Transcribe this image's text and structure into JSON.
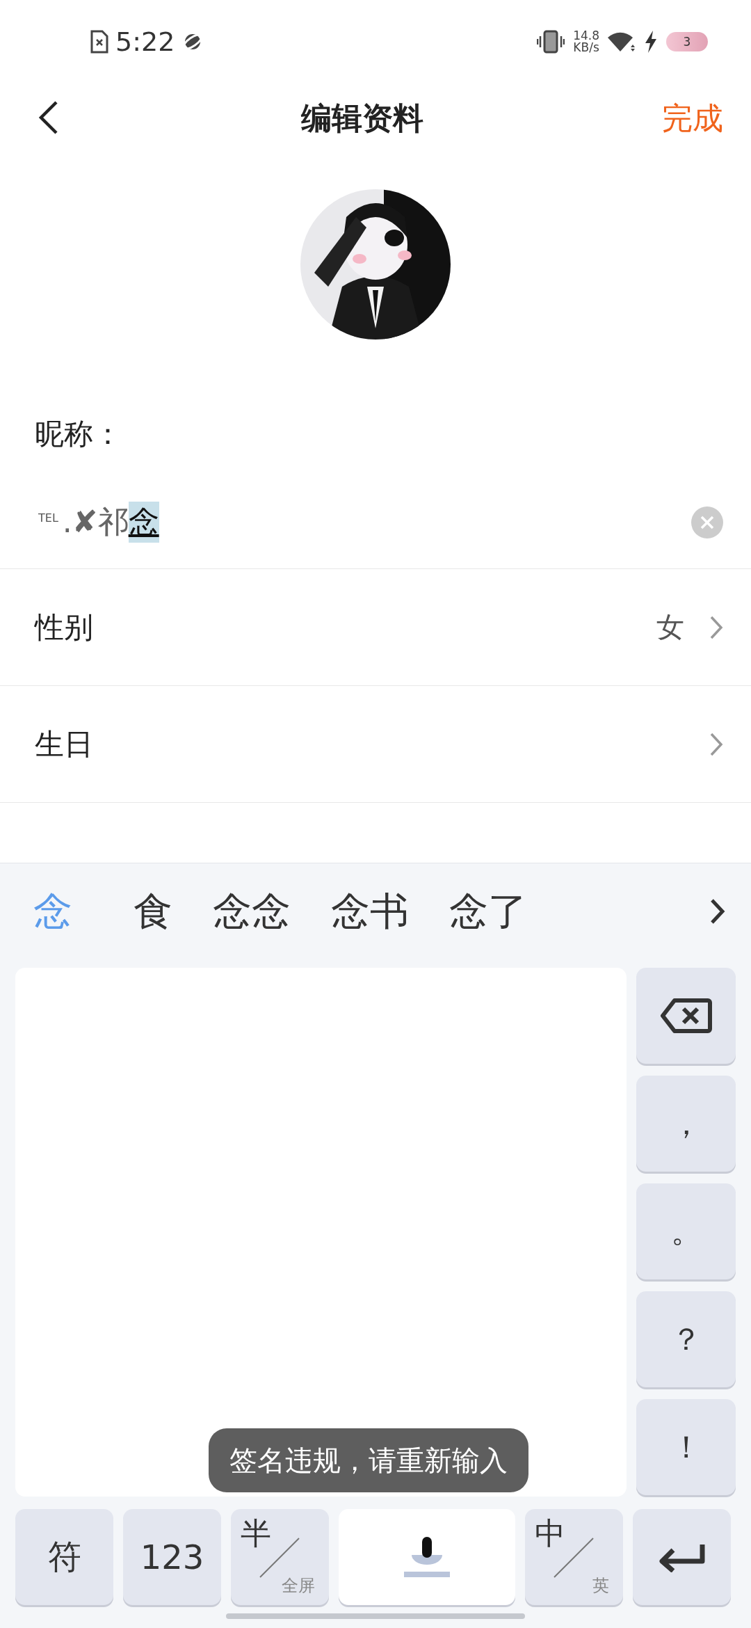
{
  "status_bar": {
    "time": "5:22",
    "net_speed": "14.8",
    "net_unit": "KB/s",
    "battery": "3"
  },
  "header": {
    "title": "编辑资料",
    "done": "完成"
  },
  "nickname": {
    "label": "昵称：",
    "tag": "TEL",
    "value": ".✘祁",
    "composing": "念"
  },
  "rows": [
    {
      "label": "性别",
      "value": "女"
    },
    {
      "label": "生日"
    }
  ],
  "candidates": [
    {
      "text": "念",
      "selected": true
    },
    {
      "text": "食",
      "selected": false
    },
    {
      "text": "念念",
      "selected": false
    },
    {
      "text": "念书",
      "selected": false
    },
    {
      "text": "念了",
      "selected": false
    }
  ],
  "side_keys": [
    {
      "kind": "backspace"
    },
    {
      "kind": "char",
      "label": "，"
    },
    {
      "kind": "char",
      "label": "。"
    },
    {
      "kind": "char",
      "label": "？"
    },
    {
      "kind": "char",
      "label": "！"
    }
  ],
  "bottom_keys": [
    {
      "kind": "char",
      "label": "符"
    },
    {
      "kind": "char",
      "label": "123"
    },
    {
      "kind": "split",
      "label": "半",
      "sub": "全屏"
    },
    {
      "kind": "voice"
    },
    {
      "kind": "split",
      "label": "中",
      "sub": "英"
    },
    {
      "kind": "enter"
    }
  ],
  "toast": "签名违规，请重新输入"
}
